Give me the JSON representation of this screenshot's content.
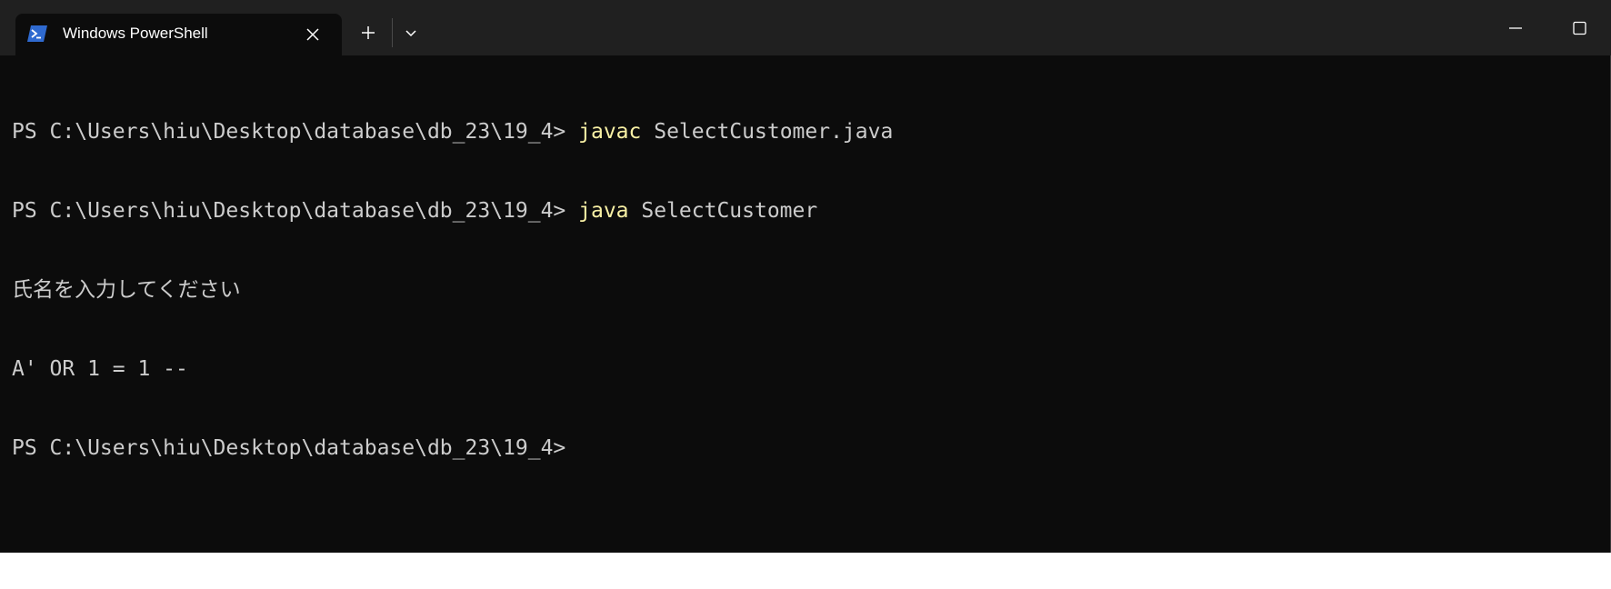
{
  "window": {
    "tab_title": "Windows PowerShell",
    "tab_icon": "powershell-icon",
    "close_icon": "close-icon",
    "new_tab_icon": "plus-icon",
    "dropdown_icon": "chevron-down-icon",
    "minimize_icon": "minimize-icon",
    "maximize_icon": "maximize-icon"
  },
  "terminal": {
    "lines": [
      {
        "prompt": "PS C:\\Users\\hiu\\Desktop\\database\\db_23\\19_4> ",
        "command": "javac",
        "args": " SelectCustomer.java"
      },
      {
        "prompt": "PS C:\\Users\\hiu\\Desktop\\database\\db_23\\19_4> ",
        "command": "java",
        "args": " SelectCustomer"
      },
      {
        "text": "氏名を入力してください"
      },
      {
        "text": "A' OR 1 = 1 --"
      },
      {
        "prompt": "PS C:\\Users\\hiu\\Desktop\\database\\db_23\\19_4>",
        "command": "",
        "args": ""
      }
    ]
  },
  "colors": {
    "background": "#0c0c0c",
    "titlebar": "#202020",
    "text": "#cccccc",
    "command": "#f9f1a5",
    "powershell_blue": "#2f6ad0"
  }
}
